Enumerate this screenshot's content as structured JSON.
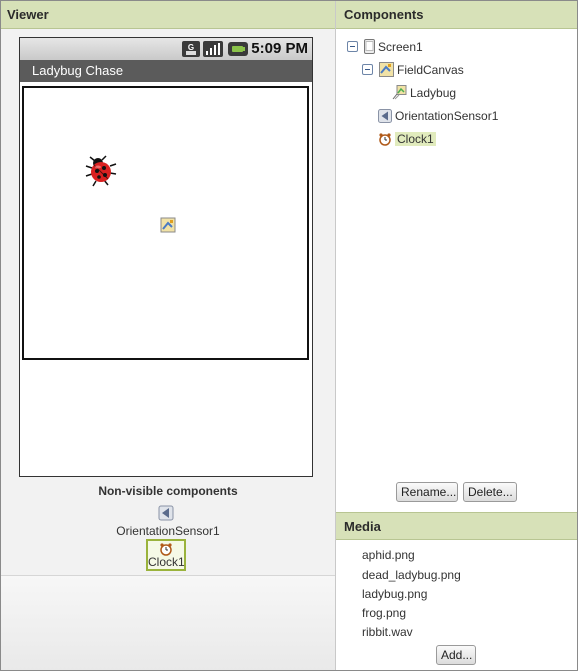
{
  "viewer": {
    "title": "Viewer",
    "phone": {
      "time": "5:09 PM",
      "app_title": "Ladybug Chase"
    },
    "nonvisible": {
      "title": "Non-visible components",
      "items": [
        {
          "label": "OrientationSensor1",
          "icon": "orientation-sensor-icon"
        },
        {
          "label": "Clock1",
          "icon": "clock-icon"
        }
      ]
    }
  },
  "components": {
    "title": "Components",
    "tree": [
      {
        "label": "Screen1",
        "icon": "screen-icon"
      },
      {
        "label": "FieldCanvas",
        "icon": "canvas-icon"
      },
      {
        "label": "Ladybug",
        "icon": "image-sprite-icon"
      },
      {
        "label": "OrientationSensor1",
        "icon": "orientation-sensor-icon"
      },
      {
        "label": "Clock1",
        "icon": "clock-icon",
        "selected": true
      }
    ],
    "rename_label": "Rename...",
    "delete_label": "Delete..."
  },
  "media": {
    "title": "Media",
    "items": [
      "aphid.png",
      "dead_ladybug.png",
      "ladybug.png",
      "frog.png",
      "ribbit.wav"
    ],
    "add_label": "Add..."
  },
  "colors": {
    "header_bg": "#d7e1b8",
    "selection": "#e1ebbd",
    "accent_border": "#9ab33c"
  }
}
